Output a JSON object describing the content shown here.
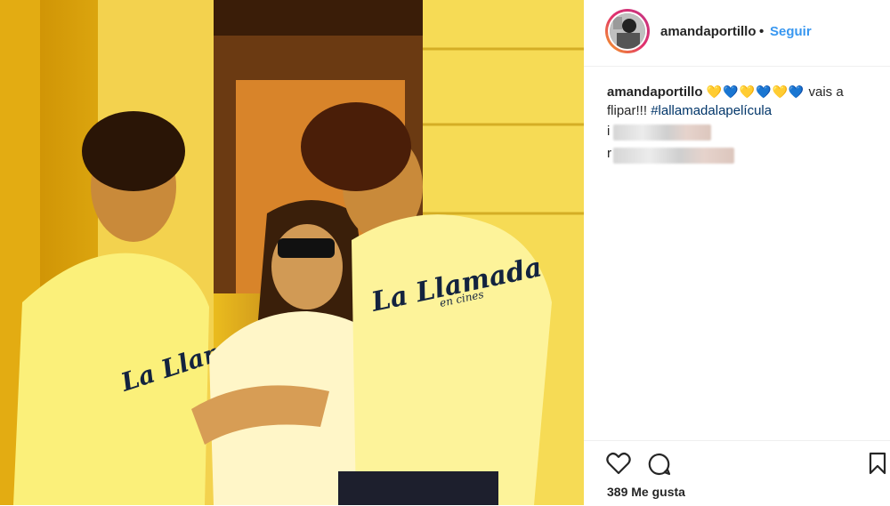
{
  "post": {
    "username": "amandaportillo",
    "separator": "•",
    "follow_label": "Seguir",
    "caption": {
      "username": "amandaportillo",
      "emojis": [
        "💛",
        "💙",
        "💛",
        "💙",
        "💛",
        "💙"
      ],
      "text": "vais a flipar!!!",
      "hashtag": "#lallamadalapelícula"
    },
    "blurred_comments": [
      {
        "visible_char": "i"
      },
      {
        "visible_char": "r"
      }
    ],
    "likes_label": "389 Me gusta",
    "shirt_text": "La Llamada",
    "shirt_subtext": "en cines",
    "colors": {
      "follow": "#3897f0",
      "hashtag": "#003569",
      "text": "#262626",
      "photo_base": "#e8b300"
    }
  },
  "icons": {
    "like": "heart-icon",
    "comment": "comment-icon",
    "save": "bookmark-icon"
  }
}
